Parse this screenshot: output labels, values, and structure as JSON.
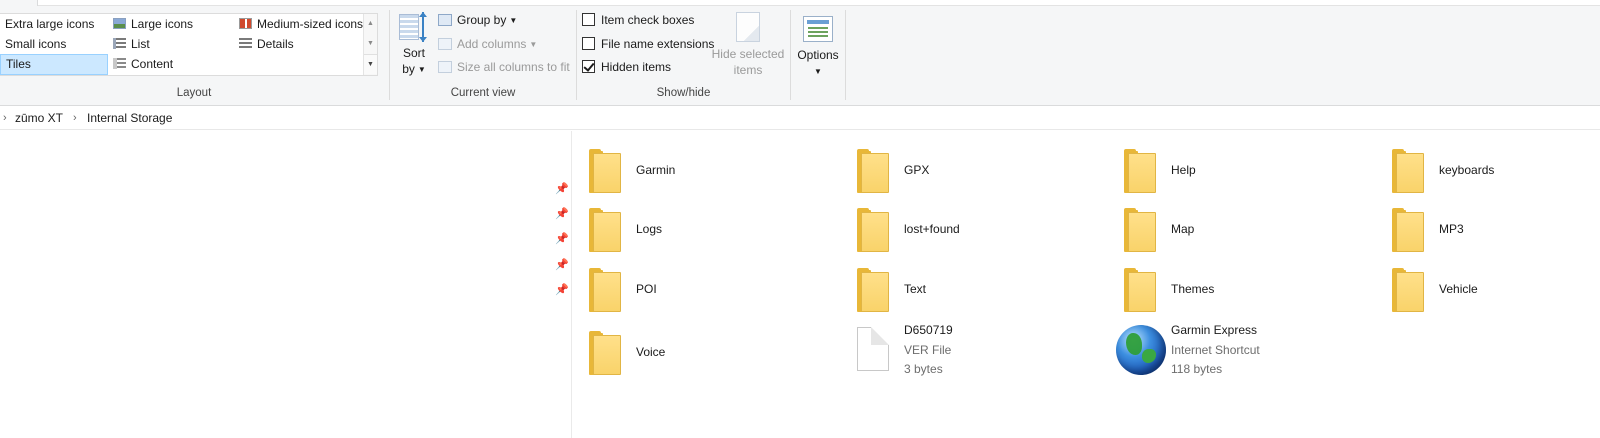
{
  "ribbon": {
    "layout": {
      "label": "Layout",
      "items": [
        {
          "label": "Extra large icons",
          "icon": "extra-large-icons-icon"
        },
        {
          "label": "Large icons",
          "icon": "large-icons-icon"
        },
        {
          "label": "Medium-sized icons",
          "icon": "medium-icons-icon"
        },
        {
          "label": "Small icons",
          "icon": "small-icons-icon"
        },
        {
          "label": "List",
          "icon": "list-icon"
        },
        {
          "label": "Details",
          "icon": "details-icon"
        },
        {
          "label": "Tiles",
          "icon": "tiles-icon",
          "selected": true
        },
        {
          "label": "Content",
          "icon": "content-icon"
        }
      ]
    },
    "current_view": {
      "label": "Current view",
      "sort_line1": "Sort",
      "sort_line2": "by",
      "group_by": "Group by",
      "add_columns": "Add columns",
      "size_columns": "Size all columns to fit"
    },
    "show_hide": {
      "label": "Show/hide",
      "checkboxes": [
        {
          "label": "Item check boxes",
          "checked": false
        },
        {
          "label": "File name extensions",
          "checked": false
        },
        {
          "label": "Hidden items",
          "checked": true
        }
      ],
      "hide_selected_line1": "Hide selected",
      "hide_selected_line2": "items"
    },
    "options": "Options"
  },
  "address": {
    "crumbs": [
      "zūmo XT",
      "Internal Storage"
    ]
  },
  "items": [
    {
      "name": "Garmin",
      "type": "folder"
    },
    {
      "name": "GPX",
      "type": "folder"
    },
    {
      "name": "Help",
      "type": "folder"
    },
    {
      "name": "keyboards",
      "type": "folder"
    },
    {
      "name": "Logs",
      "type": "folder"
    },
    {
      "name": "lost+found",
      "type": "folder"
    },
    {
      "name": "Map",
      "type": "folder"
    },
    {
      "name": "MP3",
      "type": "folder"
    },
    {
      "name": "POI",
      "type": "folder"
    },
    {
      "name": "Text",
      "type": "folder"
    },
    {
      "name": "Themes",
      "type": "folder"
    },
    {
      "name": "Vehicle",
      "type": "folder"
    },
    {
      "name": "Voice",
      "type": "folder"
    },
    {
      "name": "D650719",
      "type": "file",
      "kind": "VER File",
      "size": "3 bytes"
    },
    {
      "name": "Garmin Express",
      "type": "shortcut",
      "kind": "Internet Shortcut",
      "size": "118 bytes"
    }
  ]
}
